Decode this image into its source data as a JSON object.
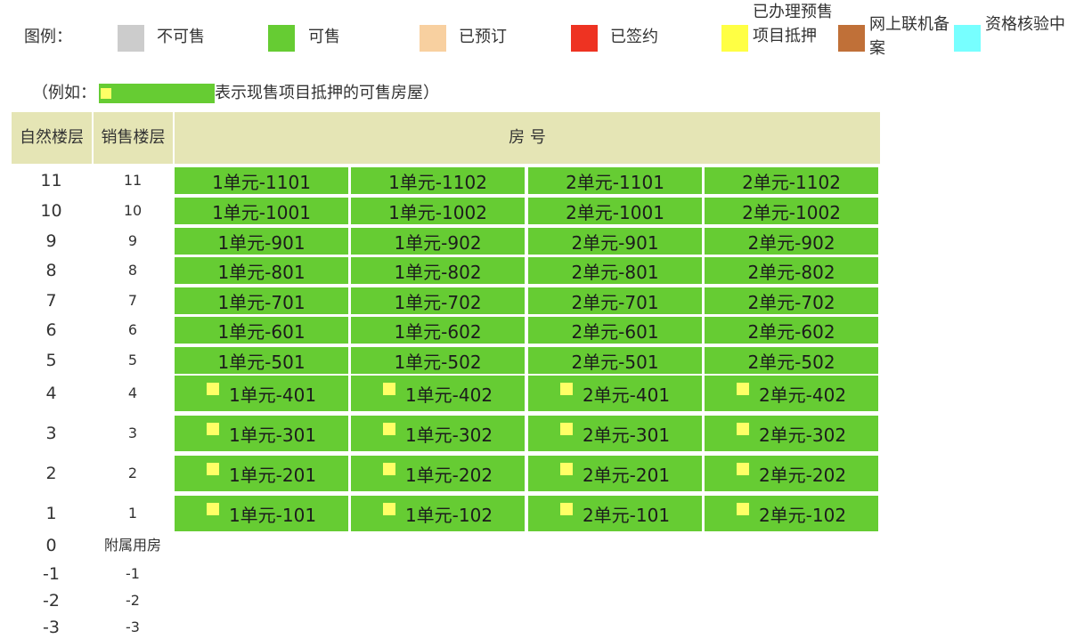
{
  "legend": {
    "title": "图例：",
    "items": [
      {
        "label": "不可售",
        "color": "#cccccc",
        "name": "not-for-sale"
      },
      {
        "label": "可售",
        "color": "#66cc33",
        "name": "for-sale"
      },
      {
        "label": "已预订",
        "color": "#f8d0a0",
        "name": "reserved"
      },
      {
        "label": "已签约",
        "color": "#ee3322",
        "name": "signed"
      },
      {
        "label": "已办理预售项目抵押",
        "color": "#ffff44",
        "name": "presale-mortgaged"
      },
      {
        "label": "网上联机备案",
        "color": "#c07038",
        "name": "online-filing"
      },
      {
        "label": "资格核验中",
        "color": "#77ffff",
        "name": "qualification-check"
      }
    ]
  },
  "example": {
    "prefix": "（例如：",
    "suffix": "表示现售项目抵押的可售房屋）"
  },
  "table": {
    "header_natural_floor": "自然楼层",
    "header_sales_floor": "销售楼层",
    "header_room_no": "房 号",
    "rows": [
      {
        "natural": "11",
        "sales": "11",
        "units": [
          "1单元-1101",
          "1单元-1102",
          "2单元-1101",
          "2单元-1102"
        ],
        "mortgaged": false
      },
      {
        "natural": "10",
        "sales": "10",
        "units": [
          "1单元-1001",
          "1单元-1002",
          "2单元-1001",
          "2单元-1002"
        ],
        "mortgaged": false
      },
      {
        "natural": "9",
        "sales": "9",
        "units": [
          "1单元-901",
          "1单元-902",
          "2单元-901",
          "2单元-902"
        ],
        "mortgaged": false
      },
      {
        "natural": "8",
        "sales": "8",
        "units": [
          "1单元-801",
          "1单元-802",
          "2单元-801",
          "2单元-802"
        ],
        "mortgaged": false
      },
      {
        "natural": "7",
        "sales": "7",
        "units": [
          "1单元-701",
          "1单元-702",
          "2单元-701",
          "2单元-702"
        ],
        "mortgaged": false
      },
      {
        "natural": "6",
        "sales": "6",
        "units": [
          "1单元-601",
          "1单元-602",
          "2单元-601",
          "2单元-602"
        ],
        "mortgaged": false
      },
      {
        "natural": "5",
        "sales": "5",
        "units": [
          "1单元-501",
          "1单元-502",
          "2单元-501",
          "2单元-502"
        ],
        "mortgaged": false
      },
      {
        "natural": "4",
        "sales": "4",
        "units": [
          "1单元-401",
          "1单元-402",
          "2单元-401",
          "2单元-402"
        ],
        "mortgaged": true
      },
      {
        "natural": "3",
        "sales": "3",
        "units": [
          "1单元-301",
          "1单元-302",
          "2单元-301",
          "2单元-302"
        ],
        "mortgaged": true
      },
      {
        "natural": "2",
        "sales": "2",
        "units": [
          "1单元-201",
          "1单元-202",
          "2单元-201",
          "2单元-202"
        ],
        "mortgaged": true
      },
      {
        "natural": "1",
        "sales": "1",
        "units": [
          "1单元-101",
          "1单元-102",
          "2单元-101",
          "2单元-102"
        ],
        "mortgaged": true
      },
      {
        "natural": "0",
        "sales": "附属用房",
        "units": [],
        "mortgaged": false
      },
      {
        "natural": "-1",
        "sales": "-1",
        "units": [],
        "mortgaged": false
      },
      {
        "natural": "-2",
        "sales": "-2",
        "units": [],
        "mortgaged": false
      },
      {
        "natural": "-3",
        "sales": "-3",
        "units": [],
        "mortgaged": false
      }
    ]
  }
}
